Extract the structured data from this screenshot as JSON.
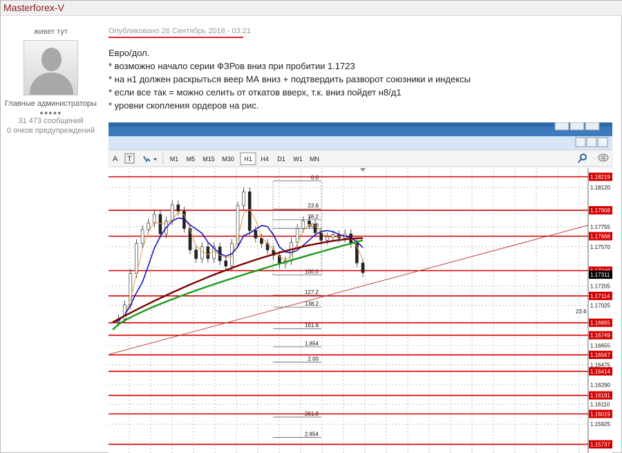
{
  "author": {
    "name": "Masterforex-V",
    "status": "живет тут",
    "avatar_icon": "default-user-avatar-icon",
    "role": "Главные администраторы",
    "rank_dots": "●●●●●",
    "posts": "31 473 сообщений",
    "warnings": "0 очков предупреждений"
  },
  "post": {
    "date": "Опубликовано 26 Сентябрь 2018 - 03:21",
    "lines": [
      "Евро/дол.",
      "* возможно начало серии ФЗРов вниз при пробитии 1.1723",
      "* на н1 должен раскрыться веер МА вниз + подтвердить разворот союзники и индексы",
      "* если все так = можно селить от откатов вверх, т.к. вниз пойдет н8/д1",
      "* уровни скопления ордеров на рис."
    ]
  },
  "chart_toolbar": {
    "tool_a": "A",
    "tool_t": "T",
    "timeframes": [
      "M1",
      "M5",
      "M15",
      "M30",
      "H1",
      "H4",
      "D1",
      "W1",
      "MN"
    ],
    "active_timeframe": "H1",
    "icons": [
      "search-icon",
      "zoom-icon"
    ]
  },
  "chart_data": {
    "type": "line",
    "title": "",
    "xlabel": "",
    "ylabel": "",
    "ylim": [
      1.1565,
      1.183
    ],
    "price_axis_ticks": [
      1.1812,
      1.17755,
      1.1757,
      1.17205,
      1.17025,
      1.16655,
      1.16475,
      1.1629,
      1.1611,
      1.15925
    ],
    "horizontal_levels": [
      1.18219,
      1.17908,
      1.17668,
      1.17348,
      1.17114,
      1.16865,
      1.16749,
      1.16567,
      1.16414,
      1.16191,
      1.16019,
      1.15737
    ],
    "current_price": 1.17311,
    "fibonacci_labels": [
      {
        "label": "0.0",
        "price": 1.1818
      },
      {
        "label": "23.6",
        "price": 1.1792
      },
      {
        "label": "38.2",
        "price": 1.1782
      },
      {
        "label": "50.0",
        "price": 1.1774
      },
      {
        "label": "100.0",
        "price": 1.1731
      },
      {
        "label": "127.2",
        "price": 1.1712
      },
      {
        "label": "138.2",
        "price": 1.1701
      },
      {
        "label": "161.8",
        "price": 1.1681
      },
      {
        "label": "1.854",
        "price": 1.1664
      },
      {
        "label": "2.00",
        "price": 1.165
      },
      {
        "label": "261.8",
        "price": 1.1599
      },
      {
        "label": "2.854",
        "price": 1.158
      }
    ],
    "side_label": "23.6",
    "colors": {
      "level_line": "#d40000",
      "level_box": "#d40000",
      "ma_fast": "#1414b8",
      "ma_slow": "#7a0000",
      "ma_long": "#1b9a1b",
      "trendline": "#c04040",
      "current_box": "#000000",
      "grid": "#9a9a9a"
    }
  }
}
